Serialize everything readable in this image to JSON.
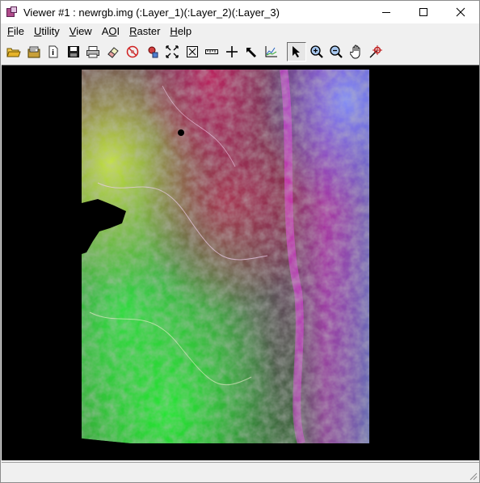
{
  "window": {
    "title": "Viewer #1 : newrgb.img (:Layer_1)(:Layer_2)(:Layer_3)",
    "app_icon": "erdas-viewer-icon"
  },
  "window_controls": {
    "minimize_icon": "minimize-icon",
    "maximize_icon": "maximize-icon",
    "close_icon": "close-icon"
  },
  "menu": {
    "items": [
      {
        "pre": "",
        "accel": "F",
        "post": "ile"
      },
      {
        "pre": "",
        "accel": "U",
        "post": "tility"
      },
      {
        "pre": "",
        "accel": "V",
        "post": "iew"
      },
      {
        "pre": "A",
        "accel": "O",
        "post": "I"
      },
      {
        "pre": "",
        "accel": "R",
        "post": "aster"
      },
      {
        "pre": "",
        "accel": "H",
        "post": "elp"
      }
    ]
  },
  "toolbar": {
    "tools": [
      "open-folder-icon",
      "open-layer-folder-icon",
      "image-info-icon",
      "save-icon",
      "print-icon",
      "eraser-icon",
      "clear-view-icon",
      "magnifier-tool-icon",
      "fit-to-window-icon",
      "scale-to-frame-icon",
      "ruler-icon",
      "crosshair-icon",
      "pointer-pick-icon",
      "profile-chart-icon",
      "select-arrow-icon",
      "zoom-in-icon",
      "zoom-out-icon",
      "pan-hand-icon",
      "inquire-cursor-icon"
    ],
    "selected_tool": "select-arrow-icon"
  },
  "viewer": {
    "image": "newrgb.img",
    "layers": [
      "Layer_1",
      "Layer_2",
      "Layer_3"
    ],
    "background_color": "#000000"
  },
  "statusbar": {
    "text": ""
  }
}
